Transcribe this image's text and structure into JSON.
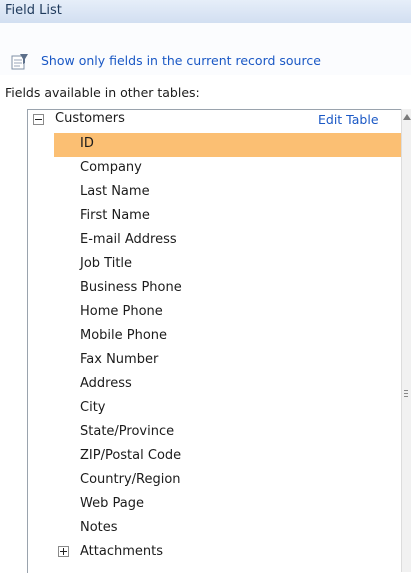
{
  "pane": {
    "title": "Field List"
  },
  "show_link": {
    "label": "Show only fields in the current record source",
    "icon": "filter-icon"
  },
  "section": {
    "label": "Fields available in other tables:"
  },
  "table": {
    "name": "Customers",
    "expanded": true,
    "edit_label": "Edit Table",
    "selected_field": "ID",
    "fields": [
      "ID",
      "Company",
      "Last Name",
      "First Name",
      "E-mail Address",
      "Job Title",
      "Business Phone",
      "Home Phone",
      "Mobile Phone",
      "Fax Number",
      "Address",
      "City",
      "State/Province",
      "ZIP/Postal Code",
      "Country/Region",
      "Web Page",
      "Notes",
      "Attachments"
    ],
    "collapsed_children": [
      "Attachments"
    ]
  },
  "colors": {
    "title_bg": "#d9e4f5",
    "link": "#1a58c5",
    "selection": "#fbbf73"
  }
}
